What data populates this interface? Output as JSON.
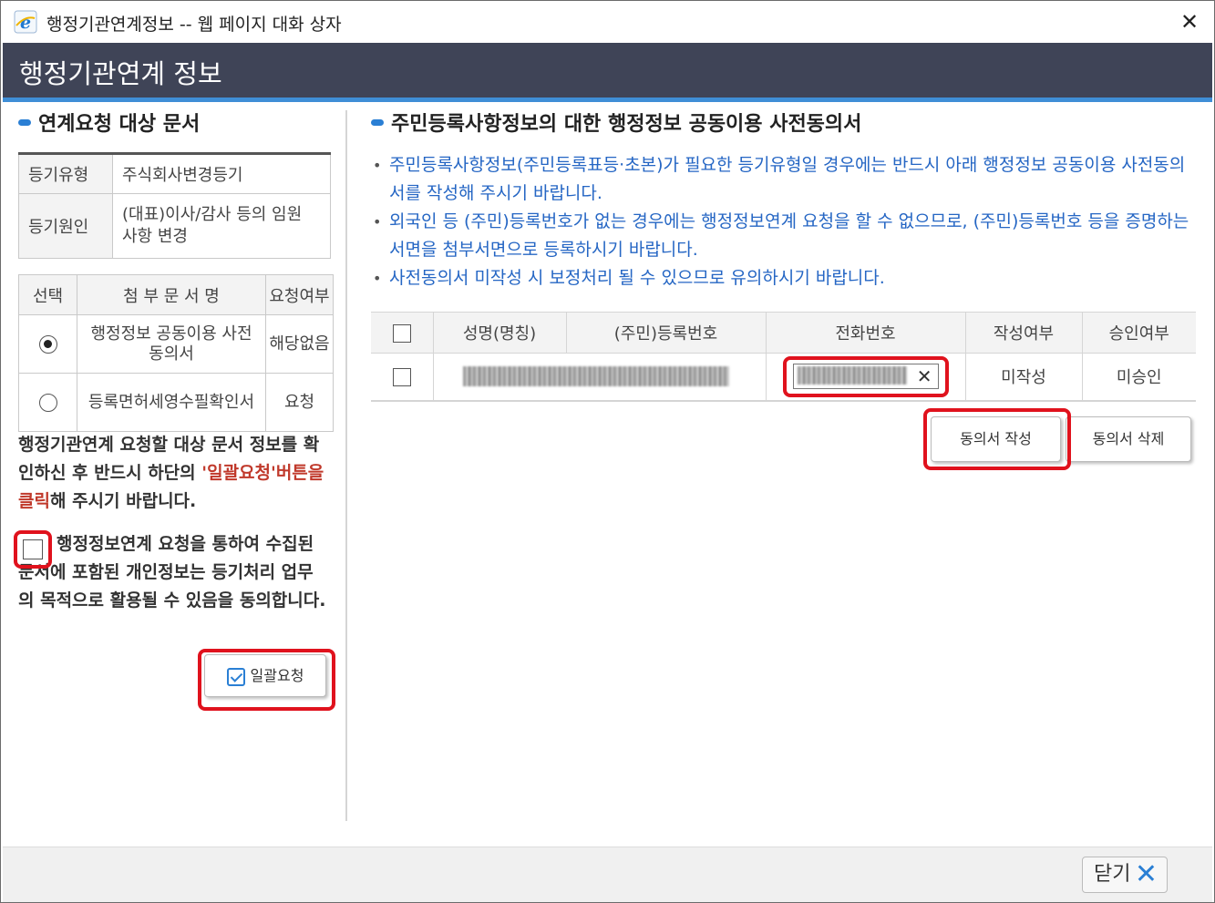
{
  "window": {
    "title": "행정기관연계정보 -- 웹 페이지 대화 상자"
  },
  "header": {
    "title": "행정기관연계 정보"
  },
  "left": {
    "section_title": "연계요청 대상 문서",
    "info": [
      {
        "label": "등기유형",
        "value": "주식회사변경등기"
      },
      {
        "label": "등기원인",
        "value": "(대표)이사/감사 등의 임원 사항 변경"
      }
    ],
    "docs_header": {
      "select": "선택",
      "name": "첨 부 문 서 명",
      "request": "요청여부"
    },
    "docs": [
      {
        "name": "행정정보 공동이용 사전동의서",
        "request": "해당없음",
        "selected": true
      },
      {
        "name": "등록면허세영수필확인서",
        "request": "요청",
        "selected": false
      }
    ],
    "notice_part1": "행정기관연계 요청할 대상 문서 정보를 확인하신 후 반드시 하단의 ",
    "notice_red": "'일괄요청'버튼을 클릭",
    "notice_part2": "해 주시기 바랍니다.",
    "agree_text": "행정정보연계 요청을 통하여 수집된 문서에 포함된 개인정보는 등기처리 업무의 목적으로 활용될 수 있음을 동의합니다.",
    "batch_button": "일괄요청"
  },
  "right": {
    "section_title": "주민등록사항정보의 대한 행정정보 공동이용 사전동의서",
    "guides": [
      "주민등록사항정보(주민등록표등·초본)가 필요한 등기유형일 경우에는 반드시 아래 행정정보 공동이용 사전동의서를 작성해 주시기 바랍니다.",
      "외국인 등 (주민)등록번호가 없는 경우에는 행정정보연계 요청을 할 수 없으므로, (주민)등록번호 등을 증명하는 서면을 첨부서면으로 등록하시기 바랍니다.",
      "사전동의서 미작성 시 보정처리 될 수 있으므로 유의하시기 바랍니다."
    ],
    "columns": [
      "성명(명칭)",
      "(주민)등록번호",
      "전화번호",
      "작성여부",
      "승인여부"
    ],
    "rows": [
      {
        "written": "미작성",
        "approved": "미승인"
      }
    ],
    "write_button": "동의서 작성",
    "delete_button": "동의서 삭제"
  },
  "footer": {
    "close_label": "닫기"
  },
  "colors": {
    "header_bg": "#3f4457",
    "accent": "#3f8ed6",
    "guide_text": "#2566c4",
    "highlight": "#e0121d"
  }
}
